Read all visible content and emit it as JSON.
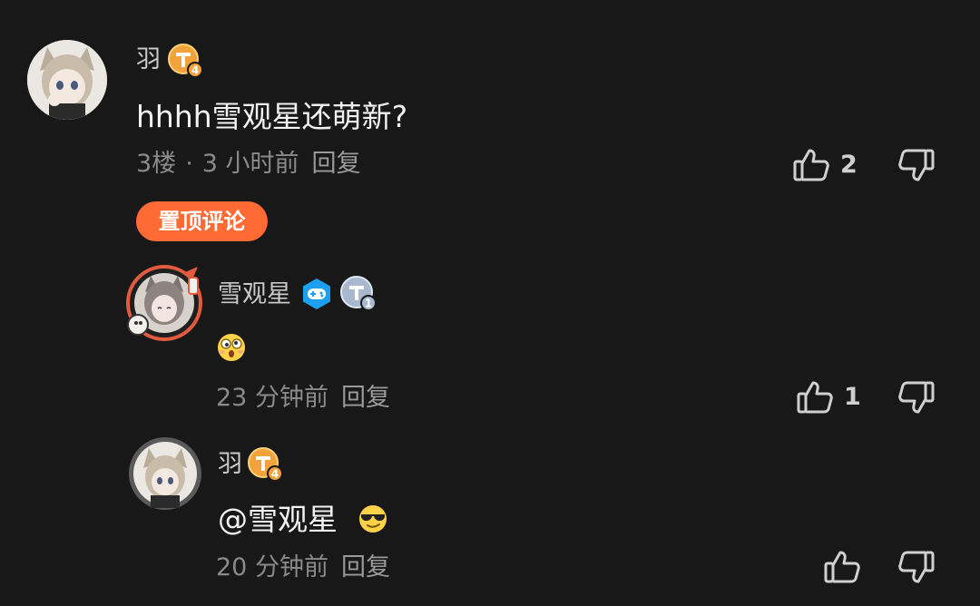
{
  "comments": [
    {
      "user": "羽",
      "level_badge": "4",
      "text": "hhhh雪观星还萌新?",
      "floor": "3楼",
      "separator": "·",
      "time": "3 小时前",
      "reply_label": "回复",
      "likes": "2",
      "pinned_label": "置顶评论"
    }
  ],
  "replies": [
    {
      "user": "雪观星",
      "level_badge": "1",
      "emoji": "😲",
      "time": "23 分钟前",
      "reply_label": "回复",
      "likes": "1"
    },
    {
      "user": "羽",
      "level_badge": "4",
      "text": "@雪观星",
      "emoji": "😎",
      "time": "20 分钟前",
      "reply_label": "回复",
      "likes": ""
    }
  ],
  "colors": {
    "background": "#181818",
    "pinned_badge": "#ff6a35",
    "level_badge_gold": "#f2a23a",
    "level_badge_silver": "#a9b8cf",
    "game_badge": "#1ea0f0"
  },
  "icons": [
    "thumbs-up-icon",
    "thumbs-down-icon",
    "game-controller-badge-icon",
    "level-badge-icon"
  ]
}
